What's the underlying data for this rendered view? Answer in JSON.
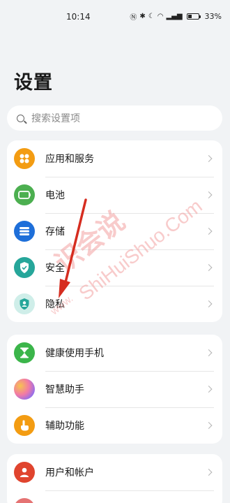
{
  "status": {
    "time": "10:14",
    "battery": "33%",
    "battery_level": 0.33
  },
  "title": "设置",
  "search": {
    "placeholder": "搜索设置项"
  },
  "group1": [
    {
      "label": "应用和服务",
      "icon": "apps-icon",
      "color": "#f39c12"
    },
    {
      "label": "电池",
      "icon": "battery-icon",
      "color": "#4caf50"
    },
    {
      "label": "存储",
      "icon": "storage-icon",
      "color": "#1e6fd9"
    },
    {
      "label": "安全",
      "icon": "security-icon",
      "color": "#26a69a"
    },
    {
      "label": "隐私",
      "icon": "privacy-icon",
      "color": "#26a69a"
    }
  ],
  "group2": [
    {
      "label": "健康使用手机",
      "icon": "hourglass-icon",
      "color": "#3bb54a"
    },
    {
      "label": "智慧助手",
      "icon": "assistant-icon",
      "color": "#e57fa8"
    },
    {
      "label": "辅助功能",
      "icon": "accessibility-icon",
      "color": "#f39c12"
    }
  ],
  "group3": [
    {
      "label": "用户和帐户",
      "icon": "user-icon",
      "color": "#e0442e"
    }
  ],
  "watermark": {
    "line1": "识会说",
    "line2": "ShiHuiShuo.Com",
    "line3": "www."
  }
}
